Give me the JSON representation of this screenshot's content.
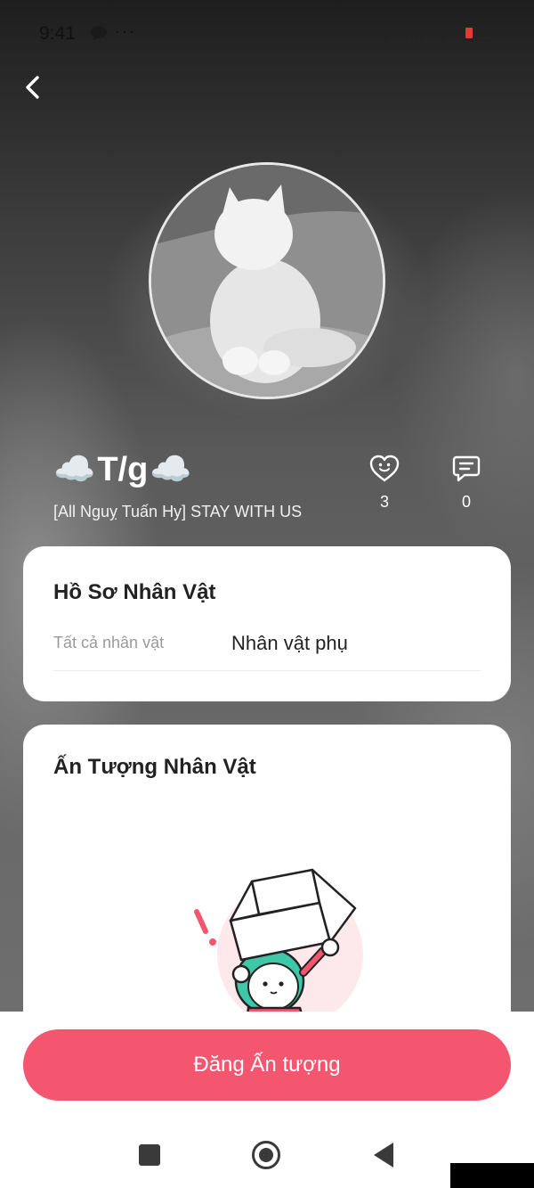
{
  "status_bar": {
    "time": "9:41",
    "dots": "···",
    "battery": "3"
  },
  "header": {
    "back_icon": "chevron-left-icon"
  },
  "character": {
    "name": "T/g",
    "name_decoration": "☁️",
    "subtitle": "[All Nguỵ Tuấn Hy] STAY WITH US",
    "likes": "3",
    "comments": "0"
  },
  "profile_card": {
    "title": "Hồ Sơ Nhân Vật",
    "row_label": "Tất cả nhân vật",
    "row_value": "Nhân vật phụ"
  },
  "impression_card": {
    "title": "Ấn Tượng Nhân Vật",
    "illustration": "empty-box-character-illustration"
  },
  "actions": {
    "post_label": "Đăng Ấn tượng"
  },
  "colors": {
    "accent": "#f45670",
    "card_bg": "#ffffff"
  }
}
